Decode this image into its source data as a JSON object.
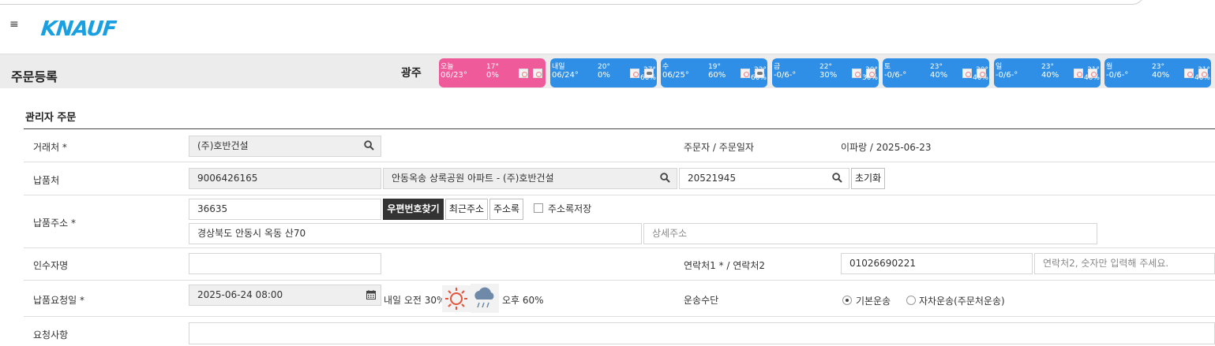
{
  "header": {
    "brand": "KNAUF",
    "menu_icon": "hamburger-icon"
  },
  "page": {
    "title": "주문등록",
    "city": "광주"
  },
  "weather": [
    {
      "day": "오늘",
      "date": "06/23°",
      "temp": "17°",
      "pop": "0%",
      "max_temp": "",
      "max_pop": "",
      "color": "#ef5a9a",
      "icon1": "sun-icon",
      "icon2": "sun-icon"
    },
    {
      "day": "내일",
      "date": "06/24°",
      "temp": "20°",
      "pop": "0%",
      "max_temp": "27°",
      "max_pop": "60%",
      "color": "#2f8fe6",
      "icon1": "sun-icon",
      "icon2": "rain-icon"
    },
    {
      "day": "수",
      "date": "06/25°",
      "temp": "19°",
      "pop": "60%",
      "max_temp": "22°",
      "max_pop": "60%",
      "color": "#2f8fe6",
      "icon1": "rain-icon",
      "icon2": "rain-icon"
    },
    {
      "day": "금",
      "date": "-0/6-°",
      "temp": "22°",
      "pop": "30%",
      "max_temp": "30°",
      "max_pop": "30%",
      "color": "#2f8fe6",
      "icon1": "sun-icon",
      "icon2": "sun-icon"
    },
    {
      "day": "토",
      "date": "-0/6-°",
      "temp": "23°",
      "pop": "40%",
      "max_temp": "30°",
      "max_pop": "40%",
      "color": "#2f8fe6",
      "icon1": "sun-icon",
      "icon2": "sun-icon"
    },
    {
      "day": "일",
      "date": "-0/6-°",
      "temp": "23°",
      "pop": "40%",
      "max_temp": "31°",
      "max_pop": "40%",
      "color": "#2f8fe6",
      "icon1": "sun-icon",
      "icon2": "sun-icon"
    },
    {
      "day": "월",
      "date": "-0/6-°",
      "temp": "23°",
      "pop": "40%",
      "max_temp": "31°",
      "max_pop": "40%",
      "color": "#2f8fe6",
      "icon1": "sun-icon",
      "icon2": "sun-icon"
    }
  ],
  "form": {
    "section_title": "관리자 주문",
    "client_label": "거래처 *",
    "client_value": "(주)호반건설",
    "orderer_label": "주문자 / 주문일자",
    "orderer_value": "이파랑 / 2025-06-23",
    "delivery_label": "납품처",
    "delivery_code": "9006426165",
    "delivery_name": "안동옥송 상록공원 아파트 - (주)호반건설",
    "delivery_code2": "20521945",
    "reset_button": "초기화",
    "address_label": "납품주소 *",
    "zipcode": "36635",
    "find_zip_button": "우편번호찾기",
    "recent_address_button": "최근주소",
    "address_book_button": "주소록",
    "save_address_label": "주소록저장",
    "address_main": "경상북도 안동시 옥동 산70",
    "address_detail_placeholder": "상세주소",
    "receiver_label": "인수자명",
    "receiver_value": "",
    "contact_label": "연락처1 * / 연락처2",
    "contact1": "01026690221",
    "contact2_placeholder": "연락처2, 숫자만 입력해 주세요.",
    "request_date_label": "납품요청일 *",
    "request_date": "2025-06-24 08:00",
    "forecast_am": "내일 오전 30%",
    "forecast_pm": "오후 60%",
    "transport_label": "운송수단",
    "transport_options": [
      "기본운송",
      "자차운송(주문처운송)"
    ],
    "transport_selected": "기본운송",
    "note_label": "요청사항",
    "note_value": ""
  }
}
